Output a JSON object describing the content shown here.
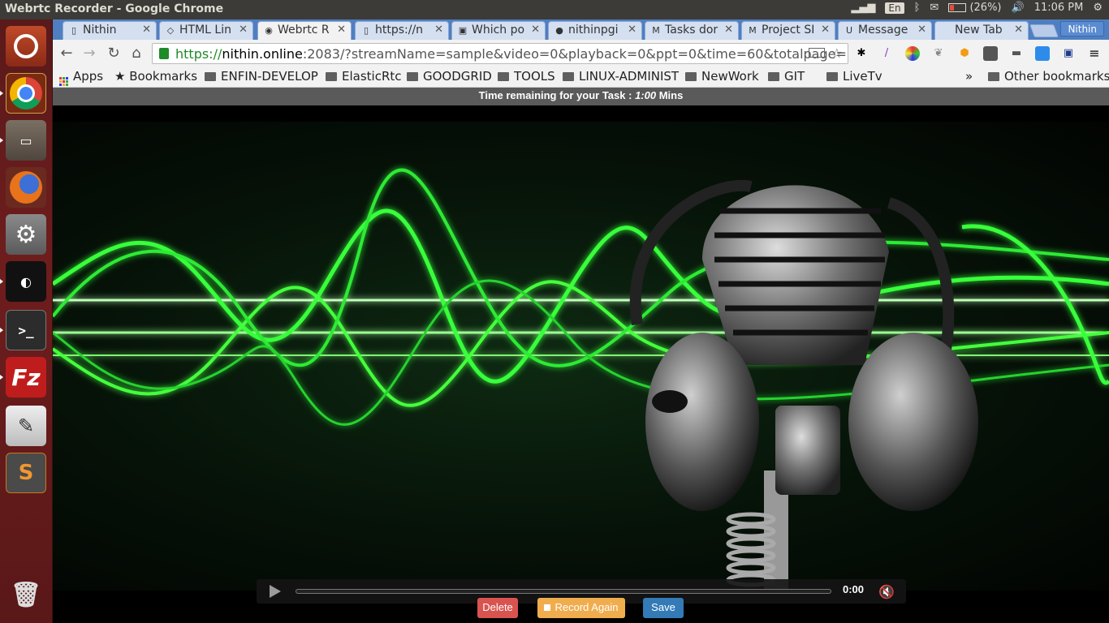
{
  "window_title": "Webrtc Recorder - Google Chrome",
  "tray": {
    "lang": "En",
    "battery": "(26%)",
    "clock": "11:06 PM"
  },
  "launcher": [
    "Ubuntu",
    "Chrome",
    "Files",
    "Firefox",
    "Settings",
    "Inkscape",
    "Terminal",
    "FileZilla",
    "Text Editor",
    "Sublime Text",
    "Trash"
  ],
  "tabs": [
    {
      "label": "Nithin",
      "icon": "doc-icon"
    },
    {
      "label": "HTML Lin",
      "icon": "html-icon"
    },
    {
      "label": "Webrtc R",
      "icon": "webrtc-icon",
      "active": true
    },
    {
      "label": "https://n",
      "icon": "doc-icon"
    },
    {
      "label": "Which po",
      "icon": "cf-icon"
    },
    {
      "label": "nithinpgi",
      "icon": "github-icon"
    },
    {
      "label": "Tasks dor",
      "icon": "gmail-icon"
    },
    {
      "label": "Project SI",
      "icon": "gmail-icon"
    },
    {
      "label": "Message",
      "icon": "upwork-icon"
    },
    {
      "label": "New Tab",
      "icon": ""
    }
  ],
  "profile": "Nithin",
  "url": {
    "scheme": "https://",
    "host": "nithin.online",
    "rest": ":2083/?streamName=sample&video=0&playback=0&ppt=0&time=60&totalpage=0#"
  },
  "bookmarks": {
    "apps": "Apps",
    "bookmarks": "Bookmarks",
    "folders": [
      "ENFIN-DEVELOP",
      "ElasticRtc",
      "GOODGRID",
      "TOOLS",
      "LINUX-ADMINIST",
      "NewWork",
      "GIT",
      "LiveTv"
    ],
    "more": "»",
    "other": "Other bookmarks"
  },
  "timer": {
    "prefix": "Time remaining for your Task : ",
    "value": "1:00",
    "suffix": " Mins"
  },
  "player": {
    "time": "0:00",
    "progress": 0
  },
  "actions": {
    "delete": "Delete",
    "record_again": "Record Again",
    "save": "Save"
  },
  "colors": {
    "accent_green": "#39ff3a",
    "delete": "#d9534f",
    "record": "#f0ad4e",
    "save": "#337ab7"
  }
}
